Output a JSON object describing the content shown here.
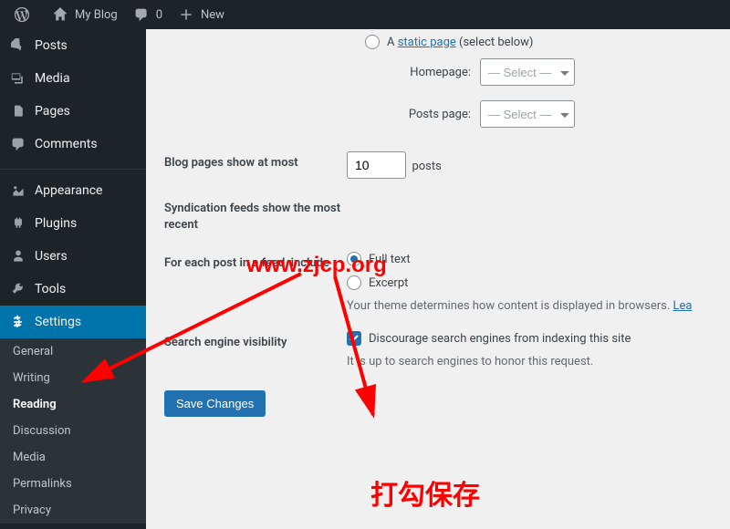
{
  "adminbar": {
    "site": "My Blog",
    "comments": "0",
    "new": "New"
  },
  "menu": {
    "posts": "Posts",
    "media": "Media",
    "pages": "Pages",
    "comments": "Comments",
    "appearance": "Appearance",
    "plugins": "Plugins",
    "users": "Users",
    "tools": "Tools",
    "settings": "Settings"
  },
  "submenu": {
    "general": "General",
    "writing": "Writing",
    "reading": "Reading",
    "discussion": "Discussion",
    "media": "Media",
    "permalinks": "Permalinks",
    "privacy": "Privacy"
  },
  "form": {
    "static_page_prefix": "A ",
    "static_page_link": "static page",
    "static_page_suffix": " (select below)",
    "homepage_label": "Homepage:",
    "posts_page_label": "Posts page:",
    "select_placeholder": "— Select —",
    "blog_pages_label": "Blog pages show at most",
    "blog_pages_value": "10",
    "blog_pages_unit": "posts",
    "syndication_label": "Syndication feeds show the most recent",
    "feed_label": "For each post in a feed, include",
    "full_text": "Full text",
    "excerpt": "Excerpt",
    "feed_desc": "Your theme determines how content is displayed in browsers. ",
    "feed_desc_link": "Lea",
    "visibility_label": "Search engine visibility",
    "visibility_check": "Discourage search engines from indexing this site",
    "visibility_desc": "It is up to search engines to honor this request.",
    "save": "Save Changes"
  },
  "annotations": {
    "watermark": "www.zjcp.org",
    "checkbox_note": "打勾保存"
  }
}
